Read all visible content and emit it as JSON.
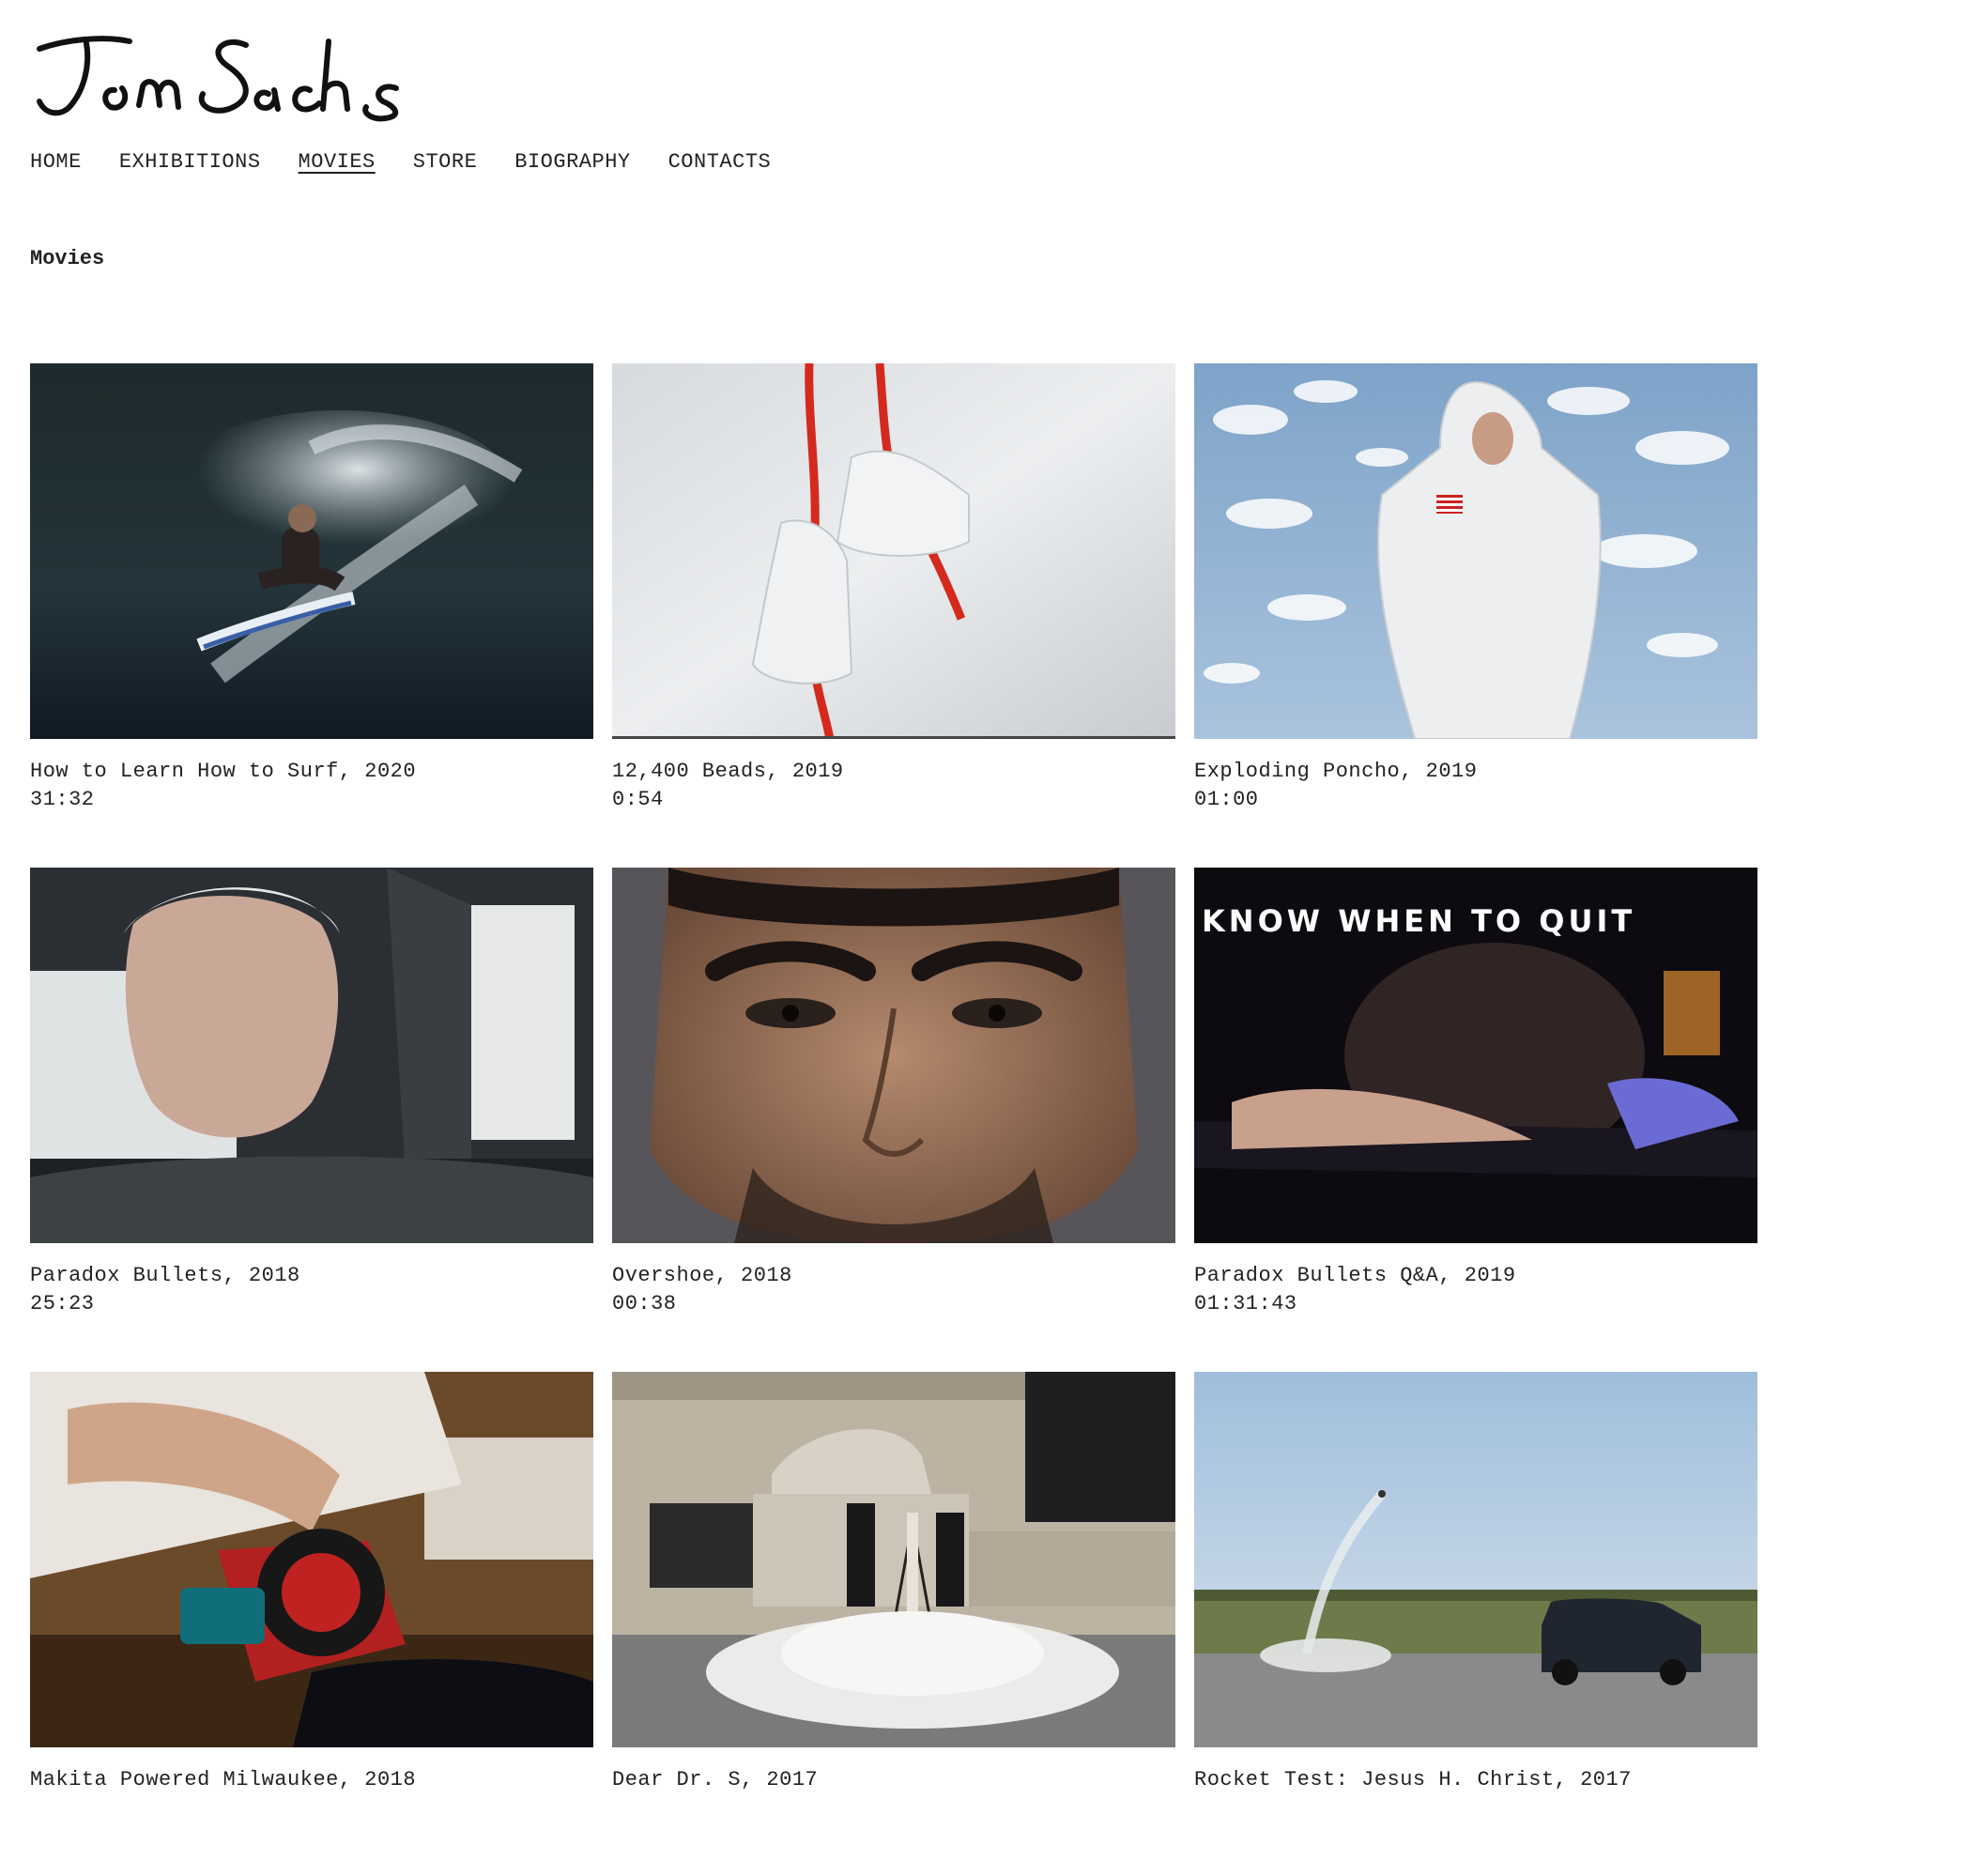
{
  "site": {
    "logo_text": "Tom Sachs"
  },
  "nav": {
    "items": [
      {
        "label": "HOME",
        "active": false
      },
      {
        "label": "EXHIBITIONS",
        "active": false
      },
      {
        "label": "MOVIES",
        "active": true
      },
      {
        "label": "STORE",
        "active": false
      },
      {
        "label": "BIOGRAPHY",
        "active": false
      },
      {
        "label": "CONTACTS",
        "active": false
      }
    ]
  },
  "page": {
    "title": "Movies"
  },
  "movies": [
    {
      "title": "How to Learn How to Surf, 2020",
      "duration": "31:32"
    },
    {
      "title": "12,400 Beads, 2019",
      "duration": "0:54"
    },
    {
      "title": "Exploding Poncho, 2019",
      "duration": "01:00"
    },
    {
      "title": "Paradox Bullets, 2018",
      "duration": "25:23"
    },
    {
      "title": "Overshoe, 2018",
      "duration": "00:38"
    },
    {
      "title": "Paradox Bullets Q&A, 2019",
      "duration": "01:31:43"
    },
    {
      "title": "Makita Powered Milwaukee, 2018",
      "duration": ""
    },
    {
      "title": "Dear Dr. S, 2017",
      "duration": ""
    },
    {
      "title": "Rocket Test: Jesus H. Christ, 2017",
      "duration": ""
    }
  ],
  "thumbnail_text": {
    "quit_banner": "KNOW WHEN TO QUIT"
  }
}
